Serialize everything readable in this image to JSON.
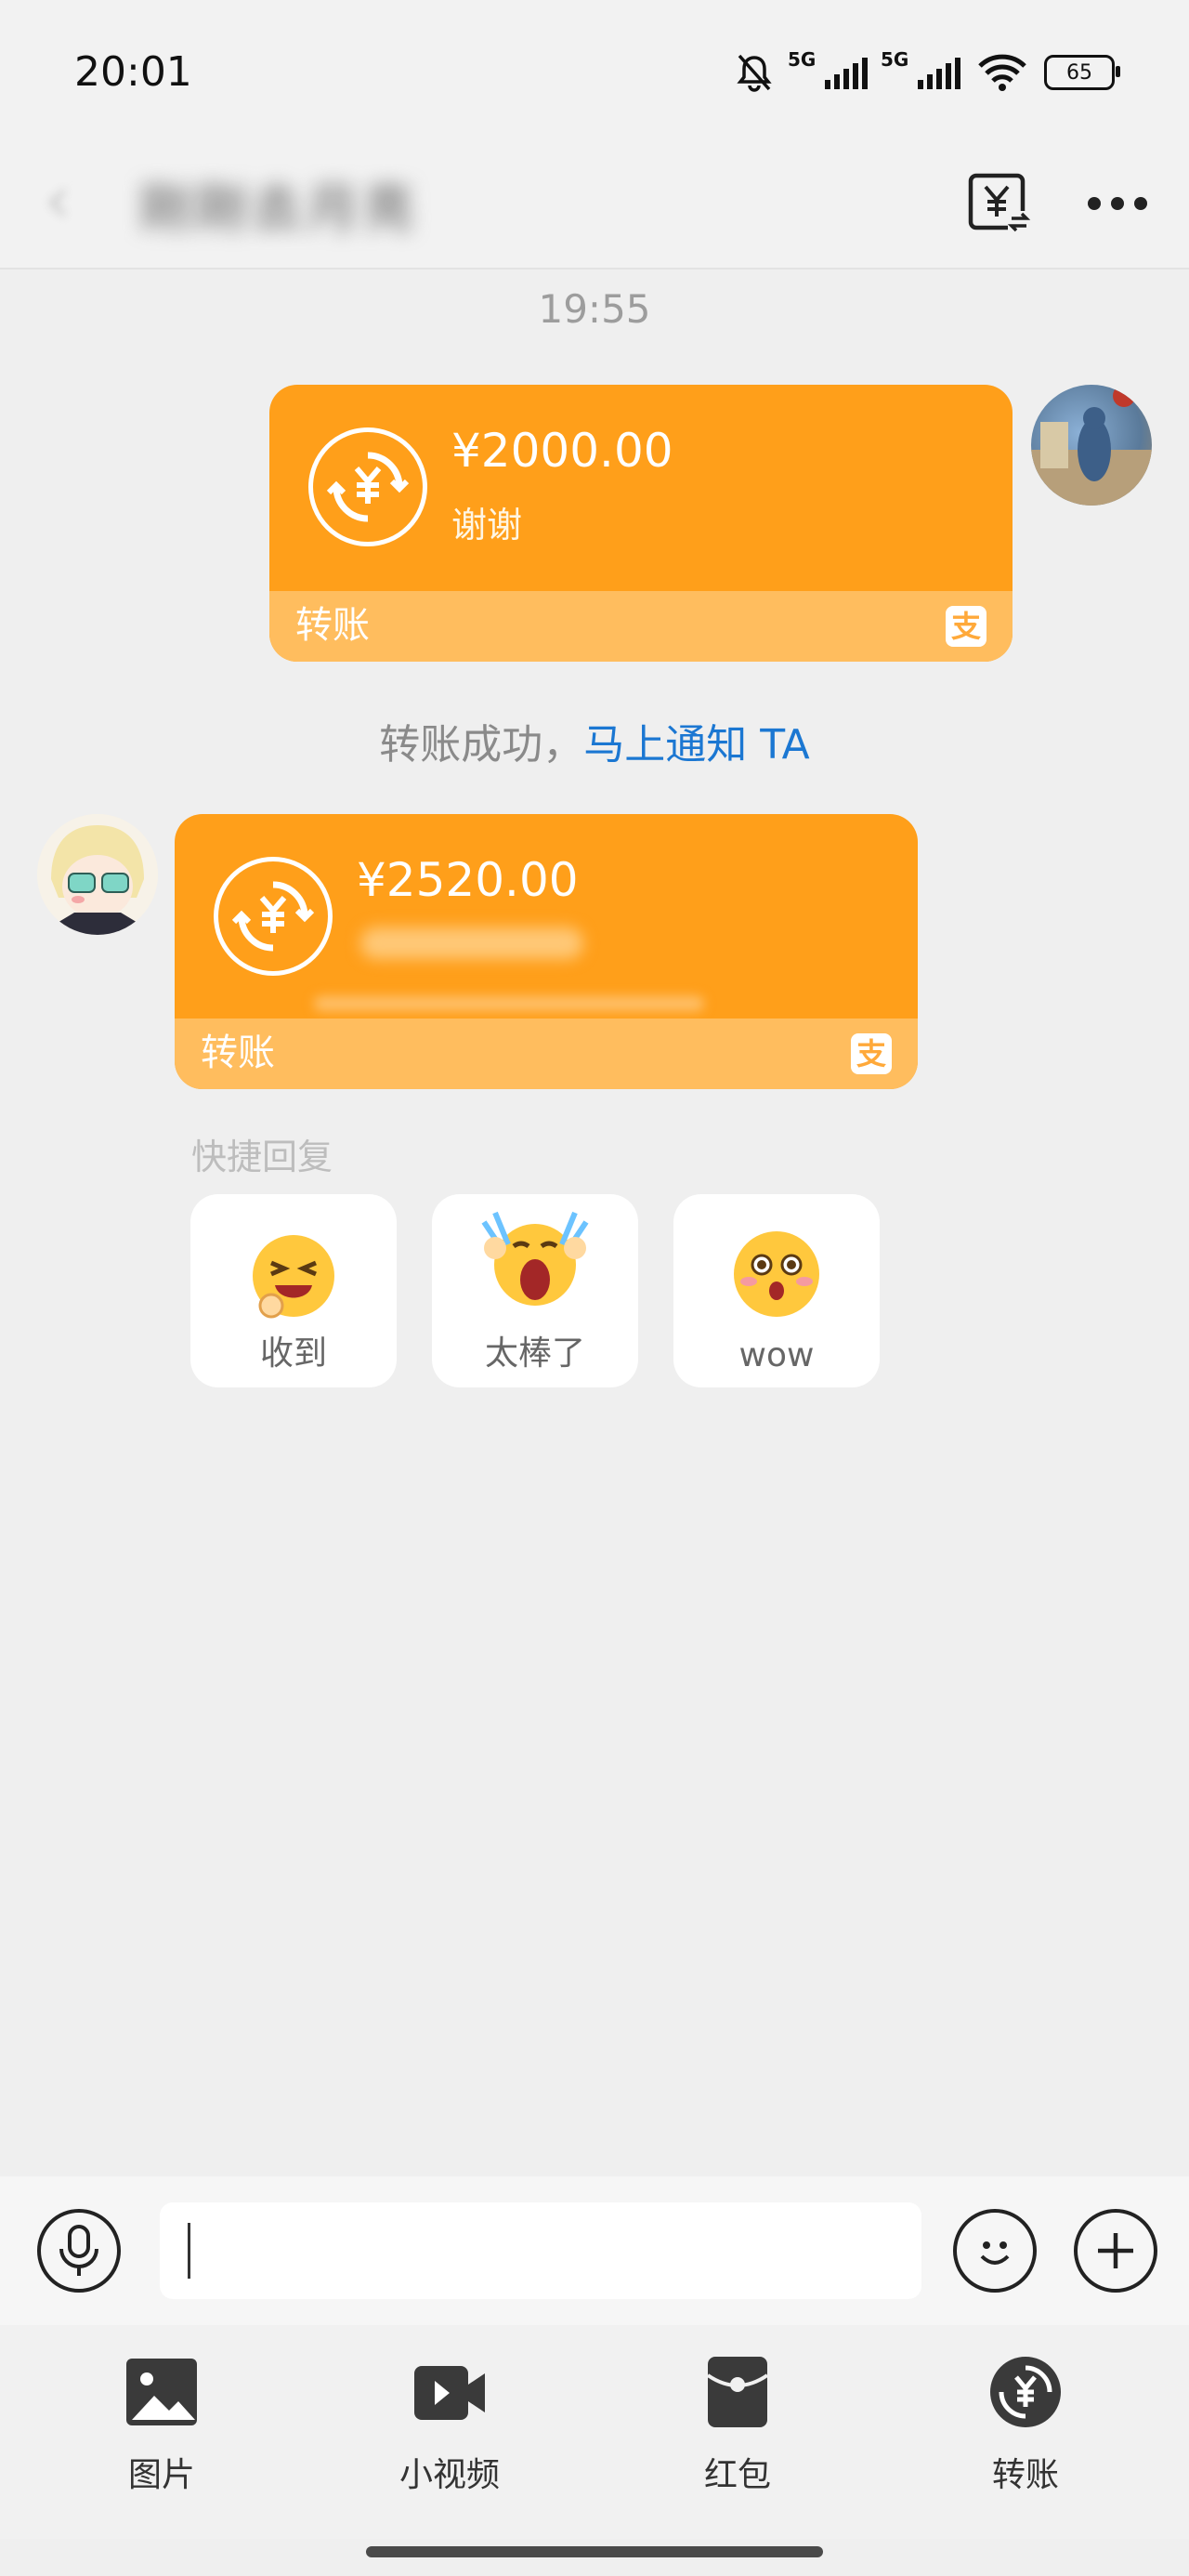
{
  "status_bar": {
    "time": "20:01",
    "network_1": "5G",
    "network_2": "5G",
    "battery": "65",
    "icons": [
      "mute-bell-icon",
      "signal-icon",
      "signal-icon",
      "wifi-icon",
      "battery-icon"
    ]
  },
  "header": {
    "back_icon": "chevron-left-icon",
    "contact_name": "刚刚去月亮",
    "transfer_record_icon": "yuan-exchange-icon",
    "more_icon": "more-dots-icon"
  },
  "chat": {
    "timestamp": "19:55",
    "messages": [
      {
        "side": "right",
        "type": "transfer",
        "amount": "¥2000.00",
        "note": "谢谢",
        "label": "转账",
        "brand_icon": "alipay-icon"
      },
      {
        "side": "left",
        "type": "transfer",
        "amount": "¥2520.00",
        "note": "",
        "label": "转账",
        "brand_icon": "alipay-icon"
      }
    ],
    "notice_text": "转账成功，",
    "notice_link": "马上通知 TA"
  },
  "quick_reply": {
    "title": "快捷回复",
    "items": [
      {
        "label": "收到",
        "icon": "ok-hand-emoji-icon"
      },
      {
        "label": "太棒了",
        "icon": "cheering-emoji-icon"
      },
      {
        "label": "wow",
        "icon": "surprised-emoji-icon"
      }
    ]
  },
  "input_bar": {
    "voice_icon": "microphone-icon",
    "input_value": "",
    "emoji_icon": "smiley-icon",
    "plus_icon": "plus-icon"
  },
  "toolbar": {
    "items": [
      {
        "label": "图片",
        "icon": "image-icon"
      },
      {
        "label": "小视频",
        "icon": "video-icon"
      },
      {
        "label": "红包",
        "icon": "red-packet-icon"
      },
      {
        "label": "转账",
        "icon": "transfer-icon"
      }
    ]
  },
  "colors": {
    "card_orange": "#ff9f1a",
    "card_footer": "#ffbd5e",
    "link_blue": "#1b77d2"
  }
}
